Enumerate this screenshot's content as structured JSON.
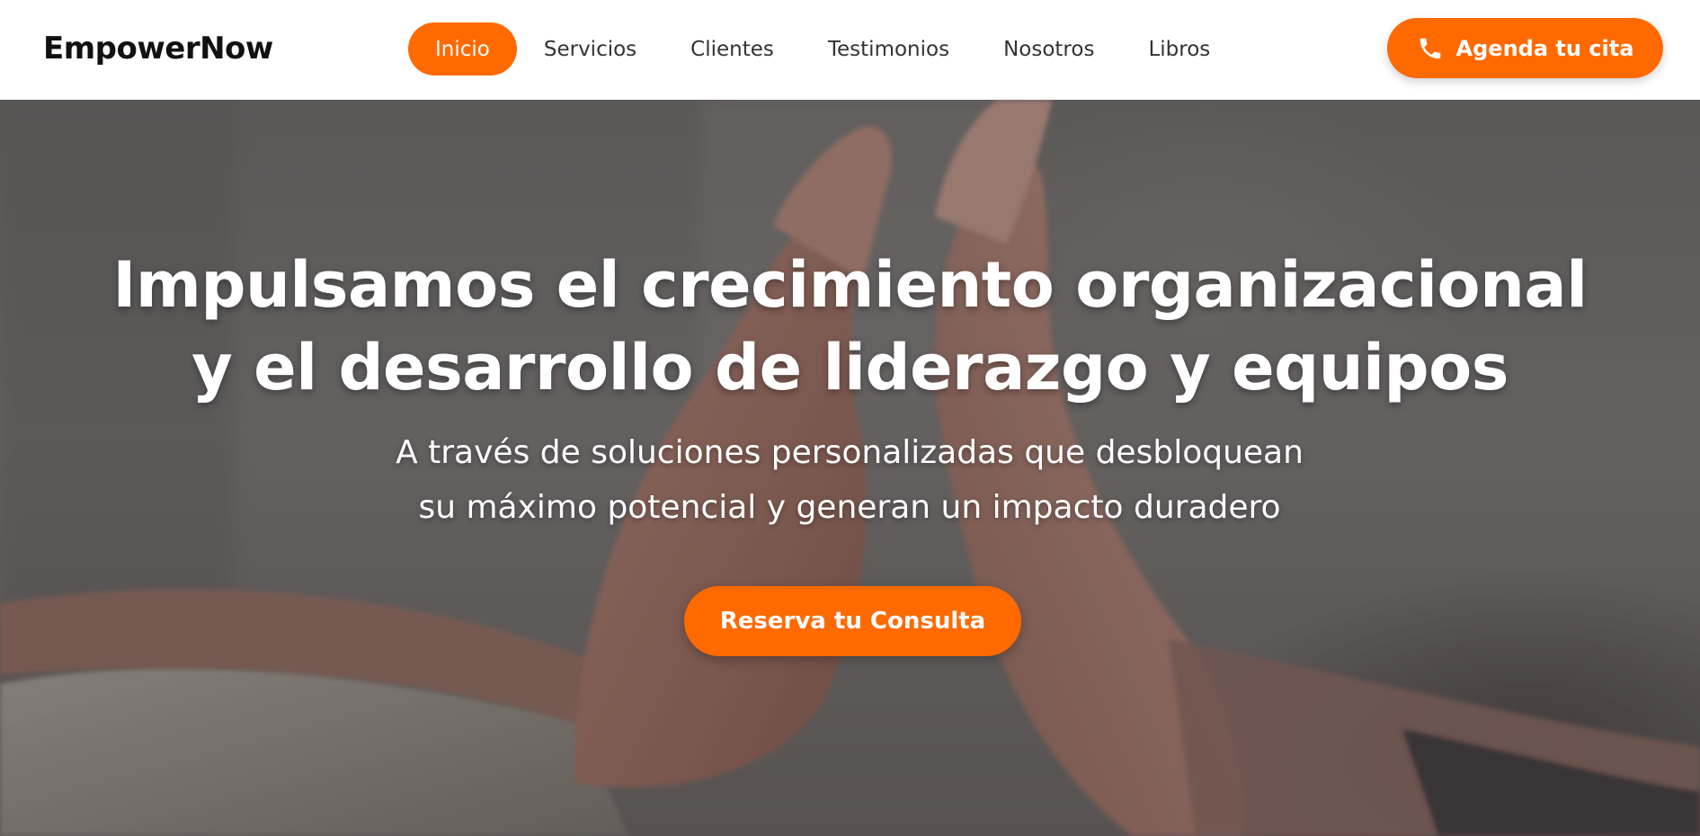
{
  "brand": {
    "name": "EmpowerNow",
    "accent_color": "#ff6a00"
  },
  "nav": {
    "items": [
      {
        "label": "Inicio",
        "active": true
      },
      {
        "label": "Servicios",
        "active": false
      },
      {
        "label": "Clientes",
        "active": false
      },
      {
        "label": "Testimonios",
        "active": false
      },
      {
        "label": "Nosotros",
        "active": false
      },
      {
        "label": "Libros",
        "active": false
      }
    ],
    "cta": {
      "label": "Agenda tu cita",
      "icon": "phone-icon"
    }
  },
  "hero": {
    "title_line1": "Impulsamos el crecimiento organizacional",
    "title_line2": "y el desarrollo de liderazgo y equipos",
    "subtitle_line1": "A través de soluciones personalizadas que desbloquean",
    "subtitle_line2": "su máximo potencial y generan un impacto duradero",
    "cta_label": "Reserva tu Consulta",
    "background_image": "hands-high-five-photo"
  }
}
